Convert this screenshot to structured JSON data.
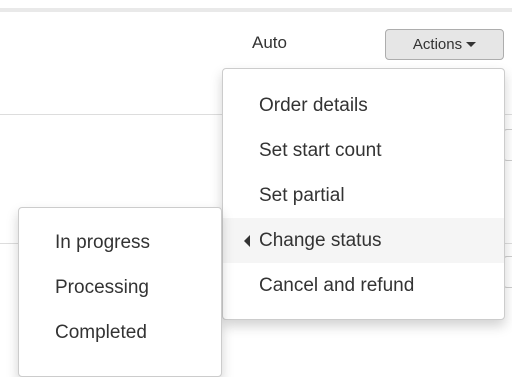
{
  "row": {
    "mode_label": "Auto"
  },
  "actions_button": {
    "label": "Actions",
    "icon": "chevron-down-icon"
  },
  "dropdown": {
    "items": [
      {
        "label": "Order details"
      },
      {
        "label": "Set start count"
      },
      {
        "label": "Set partial"
      },
      {
        "label": "Change status",
        "active": true,
        "icon": "caret-left-icon"
      },
      {
        "label": "Cancel and refund"
      }
    ]
  },
  "status_submenu": {
    "items": [
      {
        "label": "In progress"
      },
      {
        "label": "Processing"
      },
      {
        "label": "Completed"
      }
    ]
  },
  "colors": {
    "hover_background": "#f5f5f5",
    "button_background": "#e6e6e6",
    "border": "#cccccc",
    "text": "#333333"
  }
}
